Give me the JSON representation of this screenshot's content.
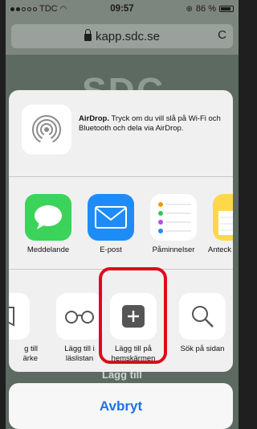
{
  "status_bar": {
    "carrier": "TDC",
    "time": "09:57",
    "battery": "86 %",
    "battery_level": 0.86
  },
  "url_bar": {
    "url": "kapp.sdc.se",
    "lock_icon": "lock-icon",
    "reload_icon": "reload-icon",
    "reload_glyph": "C"
  },
  "website": {
    "logo_text": "SDC",
    "bottom_text": "Lägg till"
  },
  "share_sheet": {
    "airdrop": {
      "title": "AirDrop.",
      "description": " Tryck om du vill slå på Wi-Fi och Bluetooth och dela via AirDrop."
    },
    "apps": [
      {
        "label": "Meddelande",
        "icon": "messages-icon",
        "color": "#3cd35a"
      },
      {
        "label": "E-post",
        "icon": "mail-icon",
        "color": "#1e8cf6"
      },
      {
        "label": "Påminnelser",
        "icon": "reminders-icon",
        "color": "#ffffff"
      },
      {
        "label": "Anteck",
        "icon": "notes-icon",
        "color": "#ffd84a"
      }
    ],
    "actions": [
      {
        "label_line1": "g till",
        "label_line2": "ärke",
        "icon": "bookmark-icon"
      },
      {
        "label_line1": "Lägg till i",
        "label_line2": "läslistan",
        "icon": "glasses-icon"
      },
      {
        "label_line1": "Lägg till på",
        "label_line2": "hemskärmen",
        "icon": "add-to-home-icon"
      },
      {
        "label_line1": "Sök på sidan",
        "label_line2": "",
        "icon": "search-icon"
      }
    ],
    "highlight_color": "#e0091c"
  },
  "cancel": {
    "label": "Avbryt",
    "color": "#1d73e6"
  }
}
